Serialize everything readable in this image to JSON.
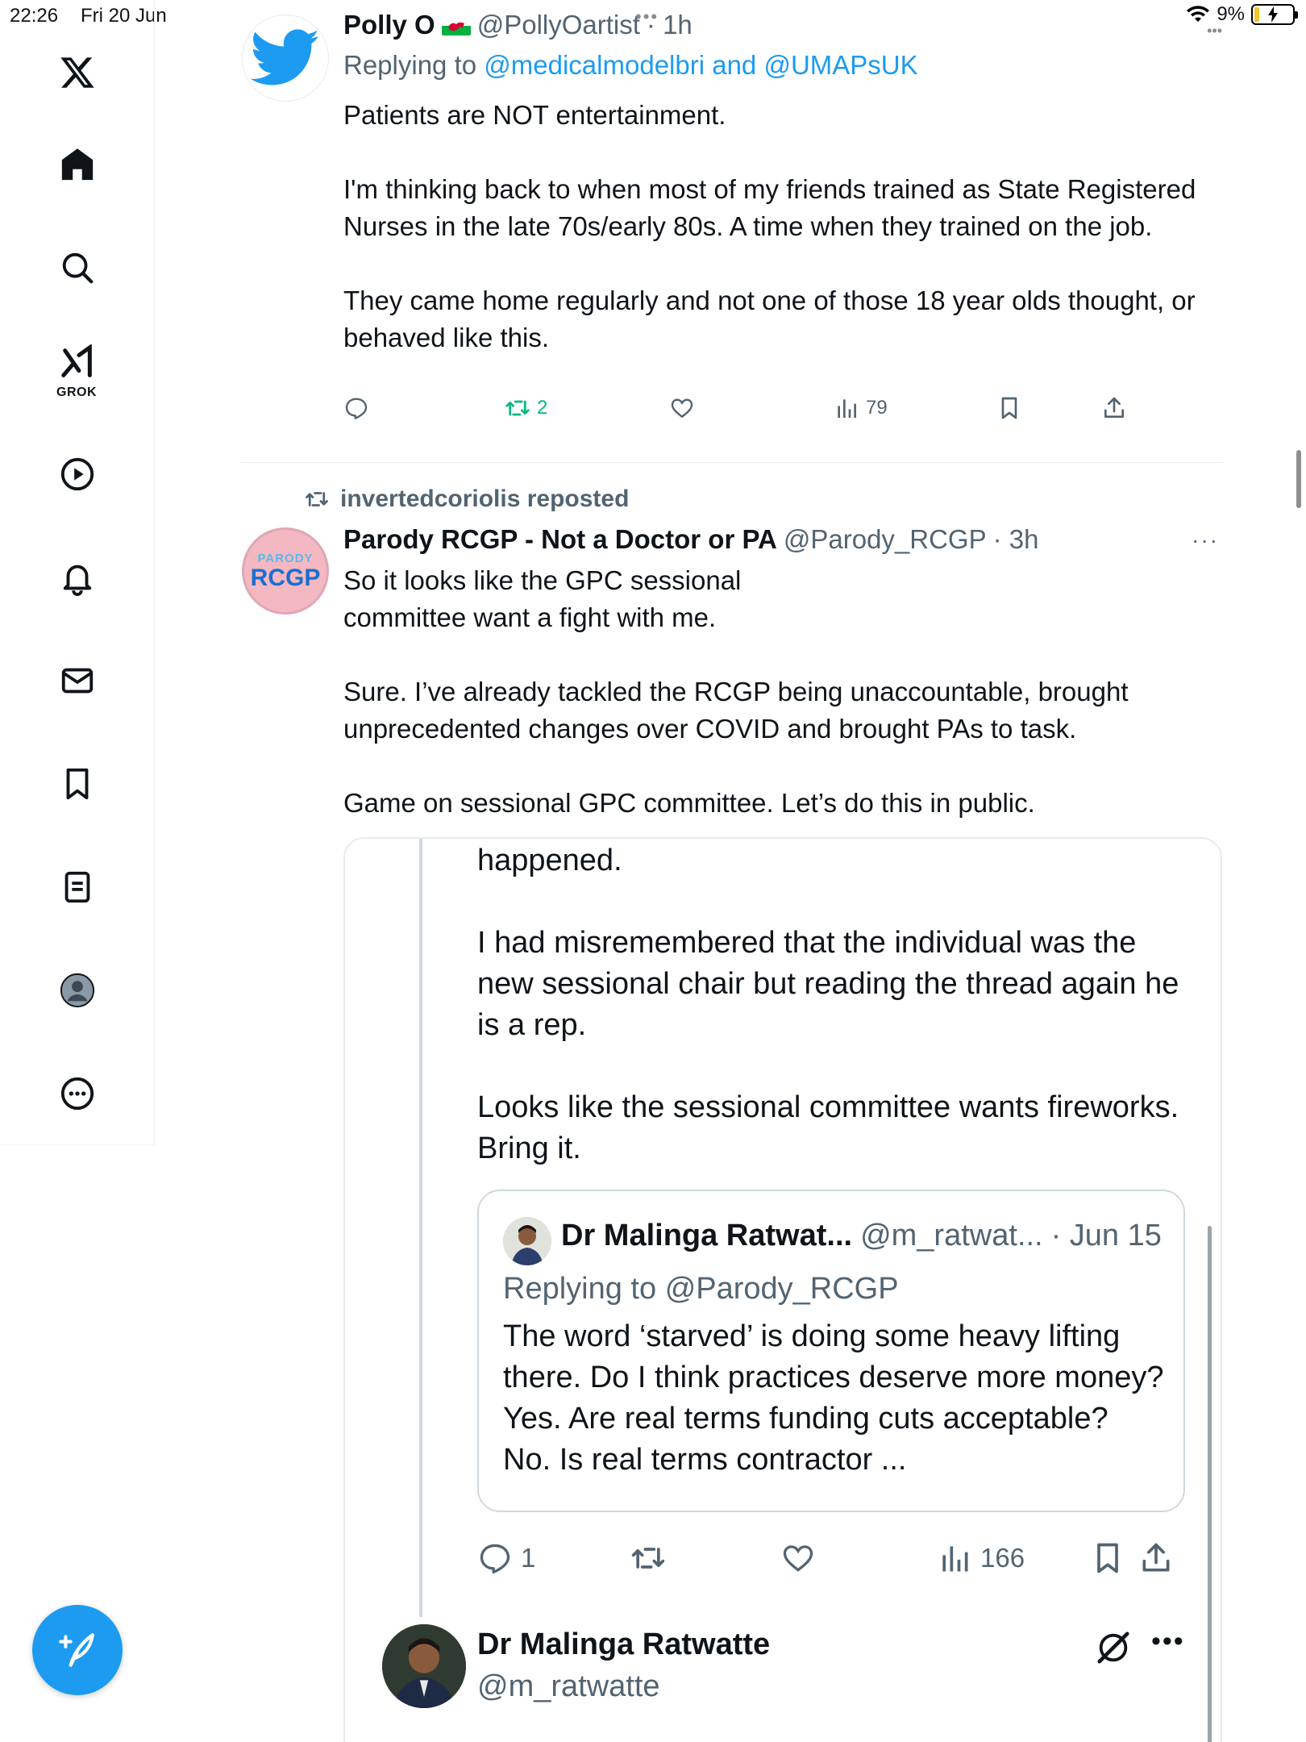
{
  "status_bar": {
    "time": "22:26",
    "date": "Fri 20 Jun",
    "battery": "9%",
    "top_dots": "•••",
    "right_dots": "•••"
  },
  "sidebar": {
    "grok_label": "GROK",
    "items": [
      "x-logo",
      "home",
      "search",
      "grok",
      "video",
      "notifications",
      "messages",
      "bookmarks",
      "lists",
      "profile",
      "more"
    ]
  },
  "tweet1": {
    "name": "Polly O",
    "handle": "@PollyOartist",
    "time": "· 1h",
    "reply_prefix": "Replying to",
    "reply_to": "@medicalmodelbri and @UMAPsUK",
    "text": "Patients are NOT  entertainment.\n\nI'm thinking back to when most of my friends trained as State Registered Nurses in the late 70s/early 80s.  A time when they trained on the job.\n\nThey came home regularly and not one of those 18 year olds thought, or behaved like this.",
    "retweets": "2",
    "views": "79"
  },
  "tweet2": {
    "repost_by": "invertedcoriolis reposted",
    "name": "Parody RCGP - Not a Doctor or PA",
    "handle": "@Parody_RCGP",
    "time": "· 3h",
    "more": "···",
    "avatar_small": "PARODY",
    "avatar_big": "RCGP",
    "text": "So it looks like the GPC sessional\ncommittee want a fight with me.\n\nSure. I’ve already tackled the RCGP being unaccountable, brought unprecedented changes over COVID and brought PAs to task.\n\nGame on sessional GPC committee. Let’s do this in public."
  },
  "quote": {
    "text": "happened.\n\nI had misremembered that the individual was the new sessional chair but reading the thread again he is a rep.\n\nLooks like the sessional committee wants fireworks. Bring it.",
    "inner": {
      "name": "Dr Malinga Ratwat...",
      "handle": "@m_ratwat...",
      "time": "· Jun 15",
      "reply_prefix": "Replying to",
      "reply_to": "@Parody_RCGP",
      "text": "The word ‘starved’ is doing some heavy lifting there. Do I think practices deserve more money? Yes. Are real terms funding cuts acceptable? No. Is real terms contractor ..."
    },
    "replies": "1",
    "views": "166",
    "next": {
      "name": "Dr Malinga Ratwatte",
      "handle": "@m_ratwatte",
      "more": "•••"
    }
  },
  "colors": {
    "accent": "#1d9bf0",
    "retweet_green": "#00ba7c",
    "secondary_text": "#536471",
    "border": "#e6ecf0"
  }
}
